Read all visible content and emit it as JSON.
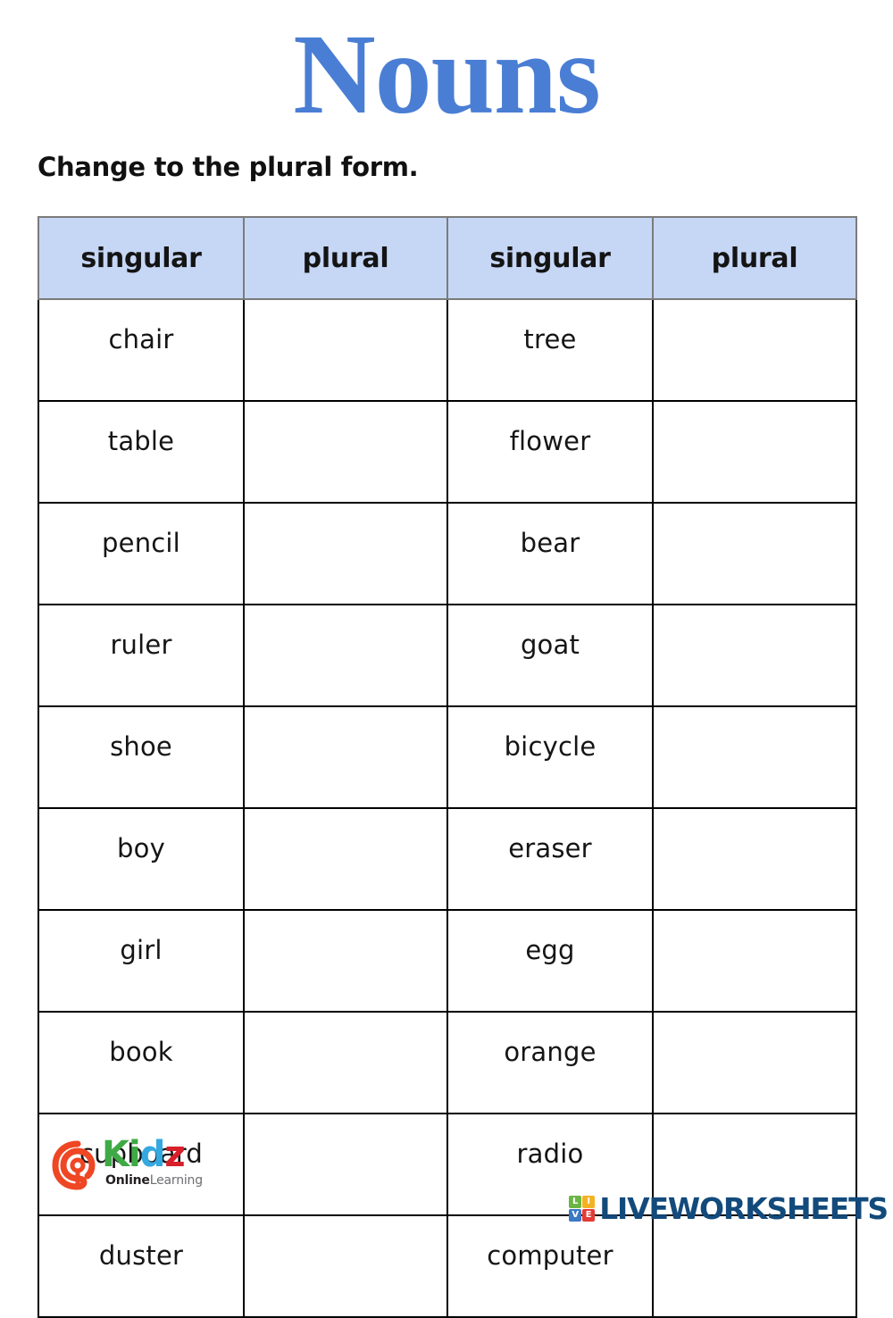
{
  "worksheet": {
    "title": "Nouns",
    "instruction": "Change to the plural form.",
    "title_color": "#4a7ed4",
    "header_bg_color": "#c6d6f5"
  },
  "table": {
    "headers": [
      "singular",
      "plural",
      "singular",
      "plural"
    ],
    "rows": [
      {
        "singular_left": "chair",
        "plural_left": "",
        "singular_right": "tree",
        "plural_right": ""
      },
      {
        "singular_left": "table",
        "plural_left": "",
        "singular_right": "flower",
        "plural_right": ""
      },
      {
        "singular_left": "pencil",
        "plural_left": "",
        "singular_right": "bear",
        "plural_right": ""
      },
      {
        "singular_left": "ruler",
        "plural_left": "",
        "singular_right": "goat",
        "plural_right": ""
      },
      {
        "singular_left": "shoe",
        "plural_left": "",
        "singular_right": "bicycle",
        "plural_right": ""
      },
      {
        "singular_left": "boy",
        "plural_left": "",
        "singular_right": "eraser",
        "plural_right": ""
      },
      {
        "singular_left": "girl",
        "plural_left": "",
        "singular_right": "egg",
        "plural_right": ""
      },
      {
        "singular_left": "book",
        "plural_left": "",
        "singular_right": "orange",
        "plural_right": ""
      },
      {
        "singular_left": "cupboard",
        "plural_left": "",
        "singular_right": "radio",
        "plural_right": ""
      },
      {
        "singular_left": "duster",
        "plural_left": "",
        "singular_right": "computer",
        "plural_right": ""
      }
    ]
  },
  "kidz_logo": {
    "mark": "kidz-q-swirl-icon",
    "letter_k": "K",
    "letter_i": "i",
    "letter_d": "d",
    "letter_z": "z",
    "tagline_bold": "Online",
    "tagline_light": "Learning",
    "colors": {
      "mark": "#ef4623",
      "k": "#3faa45",
      "i": "#3faa45",
      "d": "#35a8e0",
      "z": "#d81f2a"
    }
  },
  "liveworksheets_logo": {
    "tiles": [
      "L",
      "I",
      "V",
      "E"
    ],
    "wordmark": "LIVEWORKSHEETS",
    "wordmark_color": "#134a7c"
  }
}
